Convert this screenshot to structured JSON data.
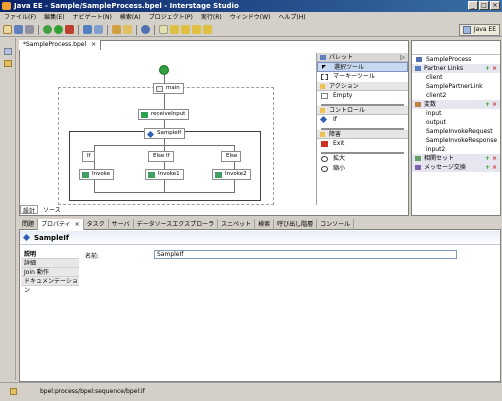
{
  "window": {
    "title": "Java EE - Sample/SampleProcess.bpel - Interstage Studio",
    "controls": [
      "_",
      "□",
      "×"
    ]
  },
  "menu": [
    "ファイル(F)",
    "編集(E)",
    "ナビゲート(N)",
    "検索(A)",
    "プロジェクト(P)",
    "実行(R)",
    "ウィンドウ(W)",
    "ヘルプ(H)"
  ],
  "perspective": {
    "label": "Java EE"
  },
  "editor": {
    "tab": "*SampleProcess.bpel",
    "bottom_tabs": [
      "設計",
      "ソース"
    ],
    "nodes": {
      "main": "main",
      "receive": "receiveInput",
      "if": "SampleIf",
      "branch1": "If",
      "branch2": "Else If",
      "branch3": "Else",
      "invoke1": "Invoke",
      "invoke2": "Invoke1",
      "invoke3": "Invoke2"
    }
  },
  "palette": {
    "title": "パレット",
    "tools": [
      "選択ツール",
      "マーキーツール"
    ],
    "sections": [
      {
        "name": "アクション",
        "items": [
          "Empty"
        ]
      },
      {
        "name": "コントロール",
        "items": [
          "If"
        ]
      },
      {
        "name": "障害",
        "items": [
          "Exit",
          "拡大",
          "縮小"
        ]
      }
    ]
  },
  "outline": {
    "root": "SampleProcess",
    "partner_links": {
      "label": "Partner Links",
      "items": [
        "client",
        "SamplePartnerLink",
        "client2"
      ]
    },
    "variables": {
      "label": "変数",
      "items": [
        "input",
        "output",
        "SampleInvokeRequest",
        "SampleInvokeResponse",
        "input2"
      ]
    },
    "correlation": "相関セット",
    "message_exchange": "メッセージ交換"
  },
  "bottom_tabs": [
    "問題",
    "プロパティ",
    "タスク",
    "サーバ",
    "データソースエクスプローラ",
    "スニペット",
    "検索",
    "呼び出し階層",
    "コンソール"
  ],
  "properties": {
    "title": "SampleIf",
    "tree": [
      "説明",
      "詳細",
      "Join 動作",
      "ドキュメンテーション"
    ],
    "name_label": "名前:",
    "name_value": "SampleIf"
  },
  "status": {
    "path": "bpel:process/bpel:sequence/bpel:if"
  }
}
